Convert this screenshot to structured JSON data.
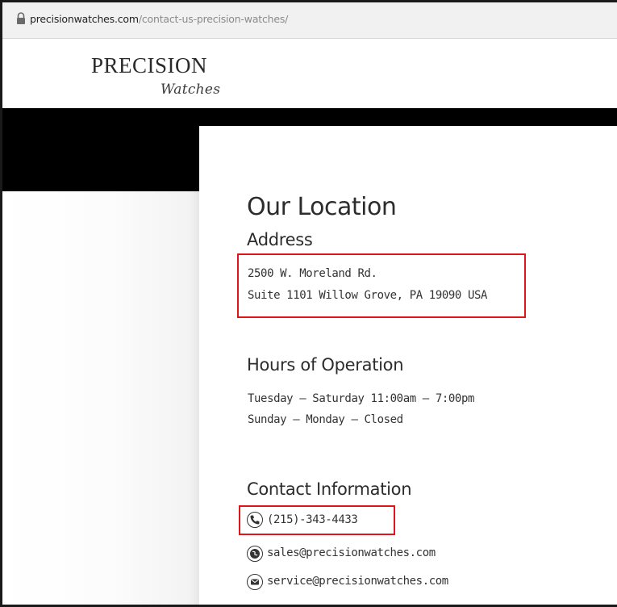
{
  "browser": {
    "url_host": "precisionwatches.com",
    "url_path": "/contact-us-precision-watches/"
  },
  "logo": {
    "main": "PRECISION",
    "script": "Watches"
  },
  "page": {
    "heading": "Our Location",
    "address": {
      "title": "Address",
      "line1": "2500 W. Moreland Rd.",
      "line2": "Suite 1101 Willow Grove, PA 19090 USA"
    },
    "hours": {
      "title": "Hours of Operation",
      "line1": "Tuesday – Saturday 11:00am – 7:00pm",
      "line2": "Sunday – Monday – Closed"
    },
    "contact": {
      "title": "Contact Information",
      "phone": "(215)-343-4433",
      "sales_email": "sales@precisionwatches.com",
      "service_email": "service@precisionwatches.com"
    }
  },
  "highlights": {
    "color": "#e0141b"
  },
  "icons": {
    "lock": "lock-icon",
    "phone": "phone-icon",
    "globe": "globe-icon",
    "mail": "mail-icon"
  }
}
